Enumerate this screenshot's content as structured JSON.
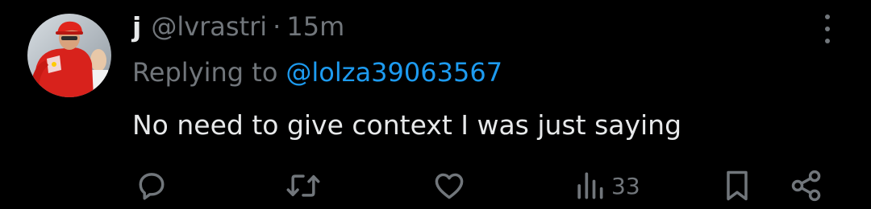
{
  "tweet": {
    "author": {
      "display_name": "j",
      "handle": "@lvrastri",
      "separator": "·",
      "time_ago": "15m"
    },
    "reply": {
      "prefix": "Replying to",
      "mention": "@lolza39063567"
    },
    "text": "No need to give context I was just saying",
    "stats": {
      "views": "33"
    },
    "actions": {
      "reply_icon": "reply-bubble-icon",
      "retweet_icon": "retweet-icon",
      "like_icon": "heart-icon",
      "views_icon": "bar-chart-icon",
      "bookmark_icon": "bookmark-icon",
      "share_icon": "share-icon"
    }
  },
  "colors": {
    "background": "#000000",
    "primary_text": "#e7e9ea",
    "secondary_text": "#71767b",
    "accent": "#1d9bf0"
  }
}
